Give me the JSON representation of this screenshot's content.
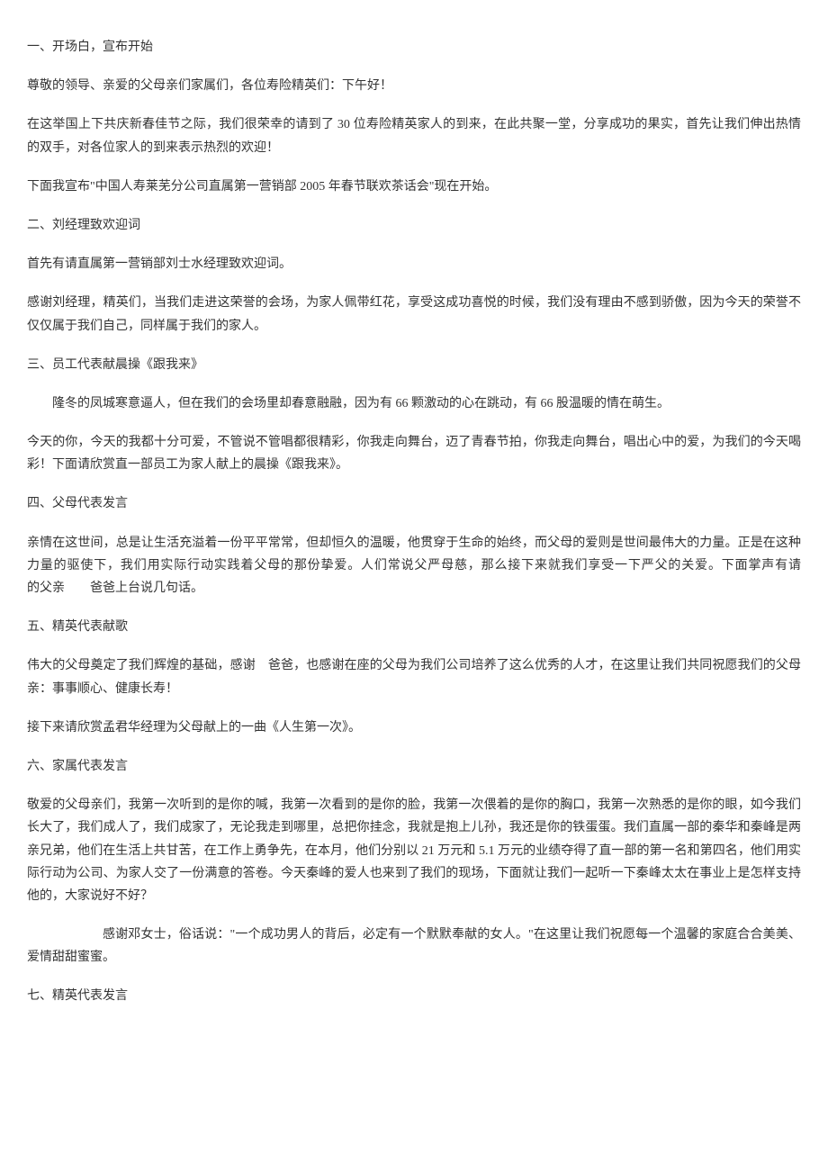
{
  "paragraphs": [
    {
      "text": "一、开场白，宣布开始",
      "class": ""
    },
    {
      "text": "尊敬的领导、亲爱的父母亲们家属们，各位寿险精英们：下午好！",
      "class": ""
    },
    {
      "text": "在这举国上下共庆新春佳节之际，我们很荣幸的请到了 30 位寿险精英家人的到来，在此共聚一堂，分享成功的果实，首先让我们伸出热情的双手，对各位家人的到来表示热烈的欢迎！",
      "class": ""
    },
    {
      "text": "下面我宣布\"中国人寿莱芜分公司直属第一营销部 2005 年春节联欢茶话会\"现在开始。",
      "class": ""
    },
    {
      "text": "二、刘经理致欢迎词",
      "class": ""
    },
    {
      "text": "首先有请直属第一营销部刘士水经理致欢迎词。",
      "class": ""
    },
    {
      "text": "感谢刘经理，精英们，当我们走进这荣誉的会场，为家人佩带红花，享受这成功喜悦的时候，我们没有理由不感到骄傲，因为今天的荣誉不仅仅属于我们自己，同样属于我们的家人。",
      "class": ""
    },
    {
      "text": "三、员工代表献晨操《跟我来》",
      "class": ""
    },
    {
      "text": "隆冬的凤城寒意逼人，但在我们的会场里却春意融融，因为有 66 颗激动的心在跳动，有 66 股温暖的情在萌生。",
      "class": "indent"
    },
    {
      "text": "今天的你，今天的我都十分可爱，不管说不管唱都很精彩，你我走向舞台，迈了青春节拍，你我走向舞台，唱出心中的爱，为我们的今天喝彩！下面请欣赏直一部员工为家人献上的晨操《跟我来》。",
      "class": ""
    },
    {
      "text": "四、父母代表发言",
      "class": ""
    },
    {
      "text": "亲情在这世间，总是让生活充溢着一份平平常常，但却恒久的温暖，他贯穿于生命的始终，而父母的爱则是世间最伟大的力量。正是在这种力量的驱使下，我们用实际行动实践着父母的那份挚爱。人们常说父严母慈，那么接下来就我们享受一下严父的关爱。下面掌声有请　　　　　　的父亲　　爸爸上台说几句话。",
      "class": ""
    },
    {
      "text": "五、精英代表献歌",
      "class": ""
    },
    {
      "text": "伟大的父母奠定了我们辉煌的基础，感谢　爸爸，也感谢在座的父母为我们公司培养了这么优秀的人才，在这里让我们共同祝愿我们的父母亲：事事顺心、健康长寿！",
      "class": ""
    },
    {
      "text": "接下来请欣赏孟君华经理为父母献上的一曲《人生第一次》。",
      "class": ""
    },
    {
      "text": "六、家属代表发言",
      "class": ""
    },
    {
      "text": "敬爱的父母亲们，我第一次听到的是你的喊，我第一次看到的是你的脸，我第一次偎着的是你的胸口，我第一次熟悉的是你的眼，如今我们长大了，我们成人了，我们成家了，无论我走到哪里，总把你挂念，我就是抱上儿孙，我还是你的铁蛋蛋。我们直属一部的秦华和秦峰是两亲兄弟，他们在生活上共甘苦，在工作上勇争先，在本月，他们分别以 21 万元和 5.1 万元的业绩夺得了直一部的第一名和第四名，他们用实际行动为公司、为家人交了一份满意的答卷。今天秦峰的爱人也来到了我们的现场，下面就让我们一起听一下秦峰太太在事业上是怎样支持他的，大家说好不好？",
      "class": ""
    },
    {
      "text": "感谢邓女士，俗话说：\"一个成功男人的背后，必定有一个默默奉献的女人。\"在这里让我们祝愿每一个温馨的家庭合合美美、爱情甜甜蜜蜜。",
      "class": "indent-more"
    },
    {
      "text": "七、精英代表发言",
      "class": ""
    }
  ]
}
